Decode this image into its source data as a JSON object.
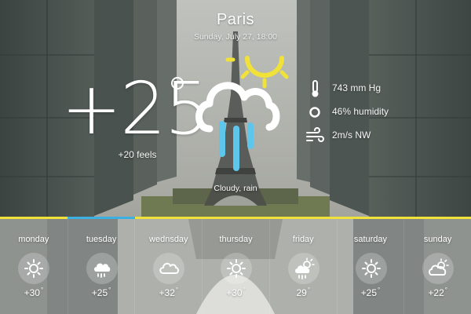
{
  "city": "Paris",
  "datetime": "Sunday, July 27, 18:00",
  "current": {
    "temp": "+25",
    "feels": "+20 feels",
    "condition": "Cloudy, rain",
    "icon": "cloud-rain-sun-icon"
  },
  "stats": [
    {
      "icon": "thermometer-icon",
      "label": "743 mm Hg"
    },
    {
      "icon": "humidity-icon",
      "label": "46% humidity"
    },
    {
      "icon": "wind-icon",
      "label": "2m/s NW"
    }
  ],
  "forecast": [
    {
      "day": "monday",
      "temp": "+30",
      "deg": "°",
      "icon": "sun-icon"
    },
    {
      "day": "tuesday",
      "temp": "+25",
      "deg": "°",
      "icon": "cloud-rain-icon"
    },
    {
      "day": "wednsday",
      "temp": "+32",
      "deg": "°",
      "icon": "cloud-icon"
    },
    {
      "day": "thursday",
      "temp": "+30",
      "deg": "°",
      "icon": "sun-icon"
    },
    {
      "day": "friday",
      "temp": "29",
      "deg": "°",
      "icon": "sun-rain-icon"
    },
    {
      "day": "saturday",
      "temp": "+25",
      "deg": "°",
      "icon": "sun-icon"
    },
    {
      "day": "sunday",
      "temp": "+22",
      "deg": "°",
      "icon": "sun-cloud-icon"
    }
  ],
  "colors": {
    "accent_yellow": "#f1e23a",
    "accent_blue": "#3db0e2",
    "rain_blue": "#5ec6ea"
  }
}
